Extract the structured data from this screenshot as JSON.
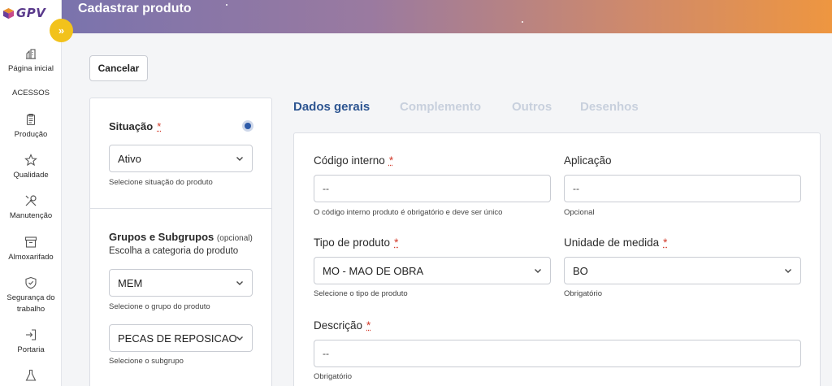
{
  "brand": {
    "logo_text": "GPV"
  },
  "header": {
    "title": "Cadastrar produto"
  },
  "sidebar": {
    "section_label": "ACESSOS",
    "items": [
      {
        "label": "Página inicial",
        "icon": "home-chart-icon"
      },
      {
        "label": "Produção",
        "icon": "clipboard-icon"
      },
      {
        "label": "Qualidade",
        "icon": "star-icon"
      },
      {
        "label": "Manutenção",
        "icon": "tools-icon"
      },
      {
        "label": "Almoxarifado",
        "icon": "archive-box-icon"
      },
      {
        "label": "Segurança do trabalho",
        "icon": "shield-check-icon"
      },
      {
        "label": "Portaria",
        "icon": "door-enter-icon"
      }
    ]
  },
  "actions": {
    "cancel_label": "Cancelar"
  },
  "left_panel": {
    "situacao": {
      "label": "Situação",
      "required_mark": "*",
      "value": "Ativo",
      "helper": "Selecione situação do produto"
    },
    "grupos": {
      "title": "Grupos e Subgrupos",
      "optional": "(opcional)",
      "description": "Escolha a categoria do produto",
      "grupo_value": "MEM",
      "grupo_helper": "Selecione o grupo do produto",
      "subgrupo_value": "PECAS DE REPOSICAO",
      "subgrupo_helper": "Selecione o subgrupo"
    }
  },
  "tabs": [
    {
      "label": "Dados gerais",
      "active": true
    },
    {
      "label": "Complemento",
      "active": false
    },
    {
      "label": "Outros",
      "active": false
    },
    {
      "label": "Desenhos",
      "active": false
    }
  ],
  "form": {
    "codigo_interno": {
      "label": "Código interno",
      "required_mark": "*",
      "value": "--",
      "helper": "O código interno produto é obrigatório e deve ser único"
    },
    "aplicacao": {
      "label": "Aplicação",
      "value": "--",
      "helper": "Opcional"
    },
    "tipo_produto": {
      "label": "Tipo de produto",
      "required_mark": "*",
      "value": "MO - MAO DE OBRA",
      "helper": "Selecione o tipo de produto"
    },
    "unidade_medida": {
      "label": "Unidade de medida",
      "required_mark": "*",
      "value": "BO",
      "helper": "Obrigatório"
    },
    "descricao": {
      "label": "Descrição",
      "required_mark": "*",
      "value": "--",
      "helper": "Obrigatório"
    }
  },
  "colors": {
    "accent": "#2d5591",
    "yellow_button": "#f2c21b",
    "required": "#d23a2a",
    "tab_inactive": "#c8d0dd"
  }
}
